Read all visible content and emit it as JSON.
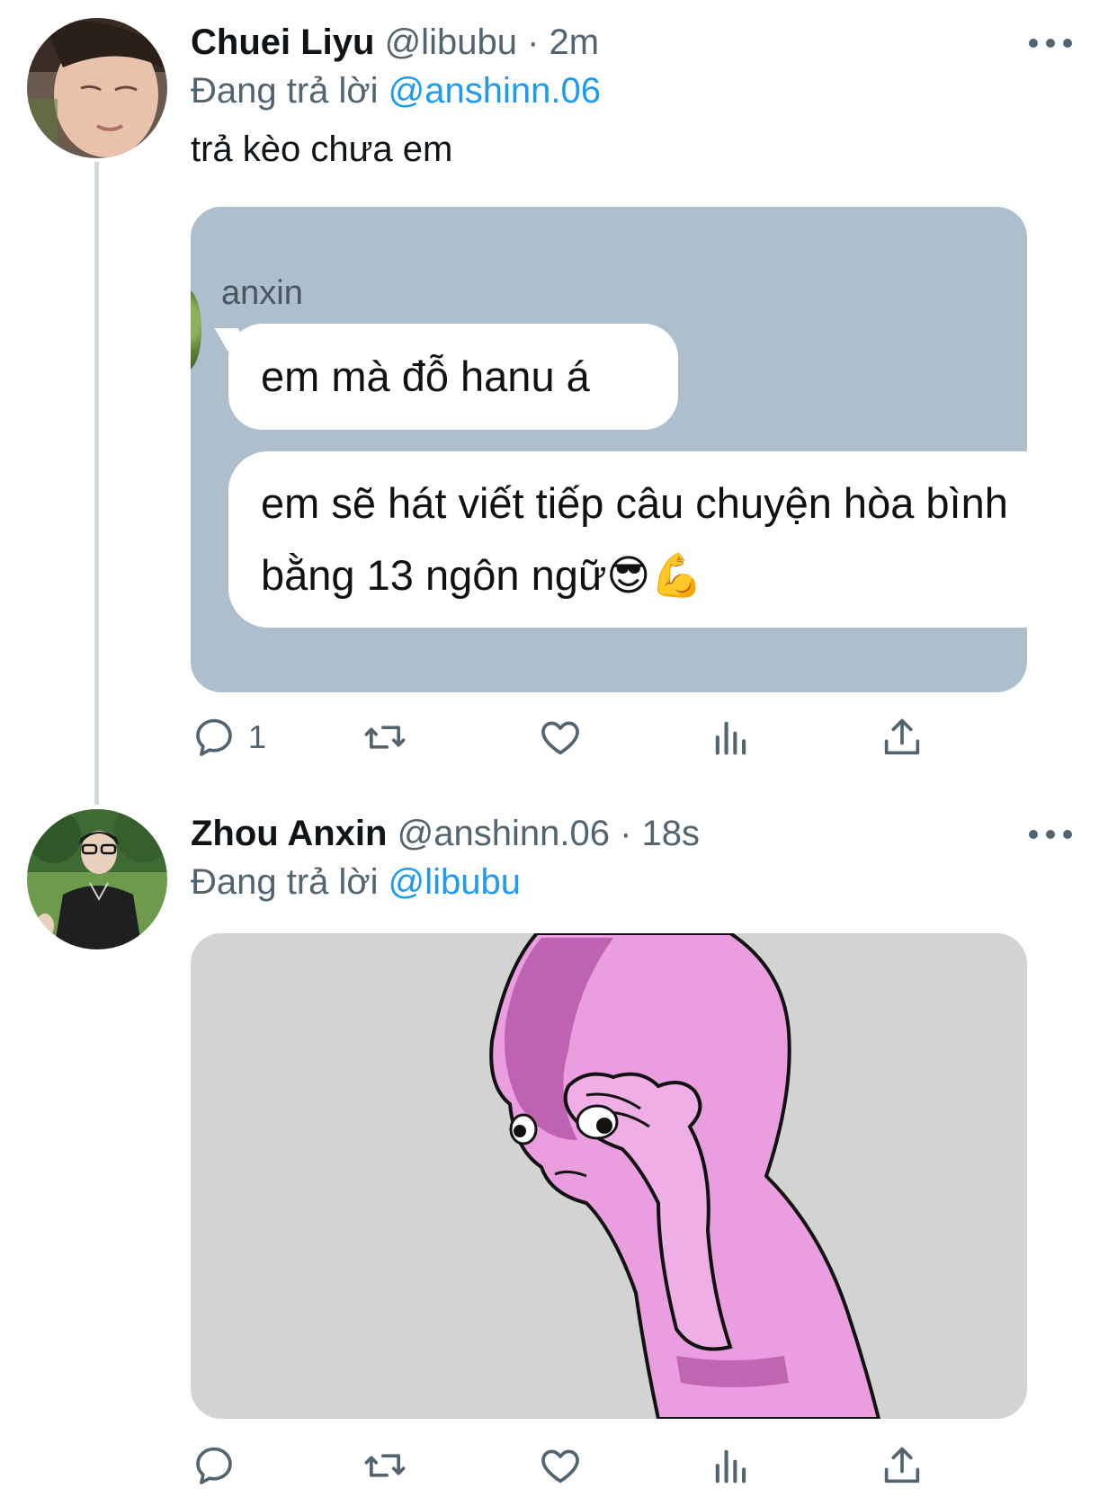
{
  "tweets": [
    {
      "display_name": "Chuei Liyu",
      "handle": "@libubu",
      "separator": "·",
      "time": "2m",
      "reply_prefix": "Đang trả lời",
      "reply_to": "@anshinn.06",
      "text": "trả kèo chưa em",
      "media": {
        "chat_sender": "anxin",
        "messages": [
          "em mà đỗ hanu á",
          "em sẽ hát viết tiếp câu chuyện hòa bình bằng 13 ngôn ngữ😎💪"
        ]
      },
      "actions": {
        "reply_count": "1",
        "retweet_count": "",
        "like_count": "",
        "views_count": ""
      }
    },
    {
      "display_name": "Zhou Anxin",
      "handle": "@anshinn.06",
      "separator": "·",
      "time": "18s",
      "reply_prefix": "Đang trả lời",
      "reply_to": "@libubu",
      "media": {
        "description_icon": "pink-meme-character-facepalm"
      },
      "actions": {
        "reply_count": "",
        "retweet_count": "",
        "like_count": "",
        "views_count": ""
      }
    }
  ],
  "colors": {
    "link": "#1d9bf0",
    "secondary": "#536471",
    "thread_line": "#cfd9de",
    "chat_bg": "#adbfcd",
    "meme_bg": "#d3d3d4",
    "meme_pink": "#e9a7dc"
  },
  "icons": [
    "reply-icon",
    "retweet-icon",
    "like-icon",
    "views-icon",
    "share-icon",
    "more-icon"
  ]
}
